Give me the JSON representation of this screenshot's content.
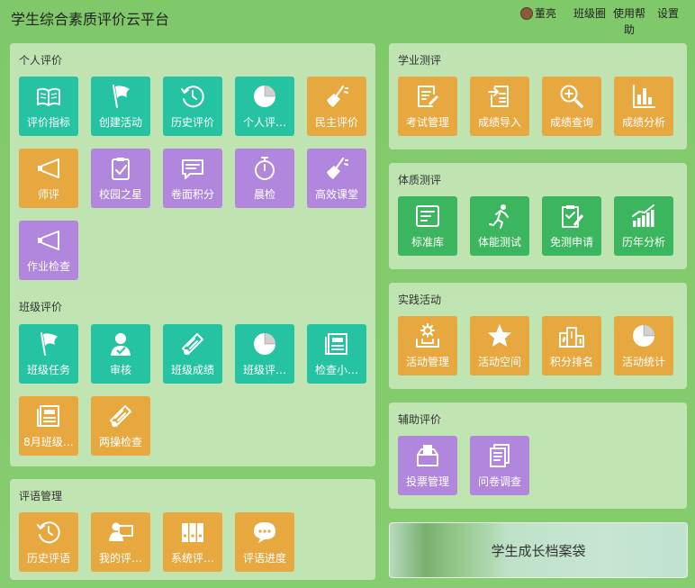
{
  "app": {
    "title": "学生综合素质评价云平台"
  },
  "nav": {
    "user": "董亮",
    "class_circle": "班级圈",
    "help_line1": "使用帮",
    "help_line2": "助",
    "settings": "设置"
  },
  "colors": {
    "teal": "#25c3a1",
    "orange": "#e7a840",
    "purple": "#b087dc",
    "green": "#3bb55e"
  },
  "personal": {
    "title": "个人评价",
    "tiles": [
      {
        "label": "评价指标",
        "icon": "book-icon",
        "color": "teal"
      },
      {
        "label": "创建活动",
        "icon": "flag-icon",
        "color": "teal"
      },
      {
        "label": "历史评价",
        "icon": "history-icon",
        "color": "teal"
      },
      {
        "label": "个人评…",
        "icon": "pie-icon",
        "color": "teal"
      },
      {
        "label": "民主评价",
        "icon": "broom-icon",
        "color": "orange"
      },
      {
        "label": "师评",
        "icon": "horn-icon",
        "color": "orange"
      },
      {
        "label": "校园之星",
        "icon": "clipboard-icon",
        "color": "purple"
      },
      {
        "label": "卷面积分",
        "icon": "chat-icon",
        "color": "purple"
      },
      {
        "label": "晨检",
        "icon": "stopwatch-icon",
        "color": "purple"
      },
      {
        "label": "高效课堂",
        "icon": "broom-icon",
        "color": "purple"
      },
      {
        "label": "作业检查",
        "icon": "horn-icon",
        "color": "purple"
      }
    ]
  },
  "class_eval": {
    "title": "班级评价",
    "tiles": [
      {
        "label": "班级任务",
        "icon": "flag-icon",
        "color": "teal"
      },
      {
        "label": "审核",
        "icon": "user-check-icon",
        "color": "teal"
      },
      {
        "label": "班级成绩",
        "icon": "diploma-icon",
        "color": "teal"
      },
      {
        "label": "班级评…",
        "icon": "pie-icon",
        "color": "teal"
      },
      {
        "label": "检查小…",
        "icon": "newspaper-icon",
        "color": "teal"
      },
      {
        "label": "8月班级…",
        "icon": "newspaper-icon",
        "color": "orange"
      },
      {
        "label": "两操检查",
        "icon": "diploma-icon",
        "color": "orange"
      }
    ]
  },
  "comments": {
    "title": "评语管理",
    "tiles": [
      {
        "label": "历史评语",
        "icon": "history-icon",
        "color": "orange"
      },
      {
        "label": "我的评…",
        "icon": "user-board-icon",
        "color": "orange"
      },
      {
        "label": "系统评…",
        "icon": "binders-icon",
        "color": "orange"
      },
      {
        "label": "评语进度",
        "icon": "chat-bubble-icon",
        "color": "orange"
      }
    ]
  },
  "academic": {
    "title": "学业测评",
    "tiles": [
      {
        "label": "考试管理",
        "icon": "edit-doc-icon",
        "color": "orange"
      },
      {
        "label": "成绩导入",
        "icon": "import-icon",
        "color": "orange"
      },
      {
        "label": "成绩查询",
        "icon": "magnifier-icon",
        "color": "orange"
      },
      {
        "label": "成绩分析",
        "icon": "analysis-icon",
        "color": "orange"
      }
    ]
  },
  "physical": {
    "title": "体质测评",
    "tiles": [
      {
        "label": "标准库",
        "icon": "terminal-icon",
        "color": "green"
      },
      {
        "label": "体能测试",
        "icon": "runner-icon",
        "color": "green"
      },
      {
        "label": "免测申请",
        "icon": "clipboard-edit-icon",
        "color": "green"
      },
      {
        "label": "历年分析",
        "icon": "bar-chart-icon",
        "color": "green"
      }
    ]
  },
  "practice": {
    "title": "实践活动",
    "tiles": [
      {
        "label": "活动管理",
        "icon": "gear-tray-icon",
        "color": "orange"
      },
      {
        "label": "活动空间",
        "icon": "star-icon",
        "color": "orange"
      },
      {
        "label": "积分排名",
        "icon": "podium-icon",
        "color": "orange"
      },
      {
        "label": "活动统计",
        "icon": "pie-icon",
        "color": "orange"
      }
    ]
  },
  "auxiliary": {
    "title": "辅助评价",
    "tiles": [
      {
        "label": "投票管理",
        "icon": "ballot-icon",
        "color": "purple"
      },
      {
        "label": "问卷调查",
        "icon": "documents-icon",
        "color": "purple"
      }
    ]
  },
  "archive": {
    "label": "学生成长档案袋"
  }
}
